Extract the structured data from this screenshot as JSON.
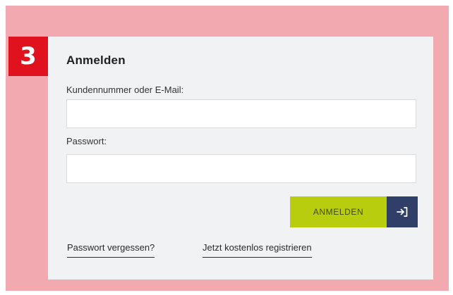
{
  "step": {
    "number": "3"
  },
  "login": {
    "title": "Anmelden",
    "customer_label": "Kundennummer oder E-Mail:",
    "customer_value": "",
    "password_label": "Passwort:",
    "password_value": "",
    "submit_label": "ANMELDEN",
    "submit_icon": "sign-in-arrow-icon",
    "forgot_password_link": "Passwort vergessen?",
    "register_link": "Jetzt kostenlos registrieren"
  },
  "colors": {
    "frame_background": "#f2a9b0",
    "step_badge": "#e0121e",
    "card_background": "#f1f2f4",
    "submit_button": "#b8cd0e",
    "submit_icon_background": "#2f3f68"
  }
}
